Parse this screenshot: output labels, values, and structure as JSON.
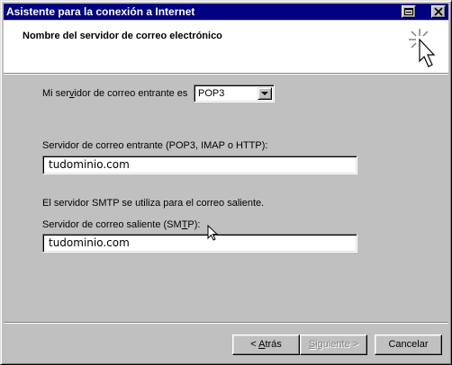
{
  "window": {
    "title": "Asistente para la conexión a Internet"
  },
  "header": {
    "title": "Nombre del servidor de correo electrónico"
  },
  "incoming_type": {
    "label_pre": "Mi ser",
    "label_mnemonic": "v",
    "label_post": "idor de correo entrante es",
    "selected": "POP3"
  },
  "incoming_server": {
    "label": "Servidor de correo entrante (POP3, IMAP o HTTP):",
    "value": "tudominio.com"
  },
  "smtp_note": "El servidor SMTP se utiliza para el correo saliente.",
  "outgoing_server": {
    "label_pre": "Servidor de correo saliente (SM",
    "label_mnemonic": "T",
    "label_post": "P):",
    "value": "tudominio.com"
  },
  "buttons": {
    "back_arrow": "< ",
    "back_mnemonic": "A",
    "back_rest": "trás",
    "next_mnemonic": "S",
    "next_rest": "iguiente >",
    "cancel": "Cancelar"
  }
}
